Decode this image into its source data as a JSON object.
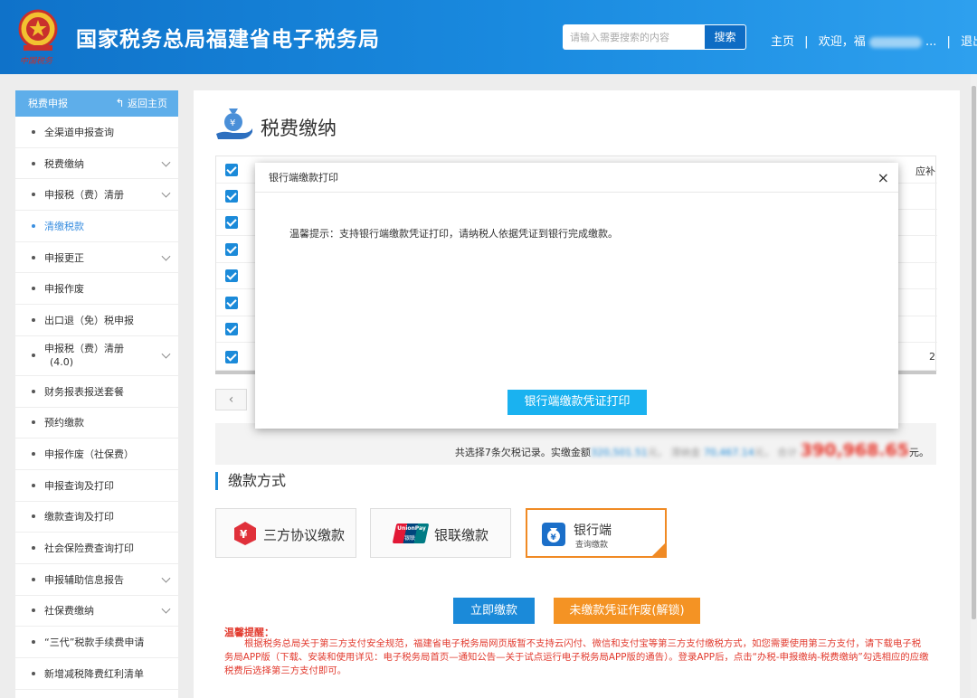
{
  "header": {
    "emblem_text": "中国税务",
    "title": "国家税务总局福建省电子税务局",
    "search_placeholder": "请输入需要搜索的内容",
    "search_button": "搜索",
    "nav_home": "主页",
    "nav_welcome": "欢迎，福",
    "nav_ellipsis": "...",
    "nav_logout": "退出",
    "separator": "|"
  },
  "sidebar": {
    "title": "税费申报",
    "back_label": "返回主页",
    "items": [
      {
        "label": "全渠道申报查询",
        "expandable": false
      },
      {
        "label": "税费缴纳",
        "expandable": true
      },
      {
        "label": "申报税（费）清册",
        "expandable": true
      },
      {
        "label": "清缴税款",
        "expandable": false,
        "active": true
      },
      {
        "label": "申报更正",
        "expandable": true
      },
      {
        "label": "申报作废",
        "expandable": false
      },
      {
        "label": "出口退（免）税申报",
        "expandable": false
      },
      {
        "label": "申报税（费）清册",
        "label2": "(4.0)",
        "expandable": true
      },
      {
        "label": "财务报表报送套餐",
        "expandable": false
      },
      {
        "label": "预约缴款",
        "expandable": false
      },
      {
        "label": "申报作废（社保费）",
        "expandable": false
      },
      {
        "label": "申报查询及打印",
        "expandable": false
      },
      {
        "label": "缴款查询及打印",
        "expandable": false
      },
      {
        "label": "社会保险费查询打印",
        "expandable": false
      },
      {
        "label": "申报辅助信息报告",
        "expandable": true
      },
      {
        "label": "社保费缴纳",
        "expandable": true
      },
      {
        "label": "“三代”税款手续费申请",
        "expandable": false
      },
      {
        "label": "新增减税降费红利清单",
        "expandable": false
      }
    ]
  },
  "main": {
    "page_title": "税费缴纳",
    "table": {
      "partial_header": "应补",
      "partial_value": "2",
      "rows_checked": 8
    },
    "pager_prev": "‹",
    "summary": {
      "prefix": "共选择7条欠税记录。实缴金额",
      "amount1": "320,501.51",
      "unit1": "元，",
      "mid_label": "滞纳金",
      "amount2": "70,467.14",
      "unit2": "元，",
      "total_label": "合计",
      "total": "390,968.65",
      "suffix": "元。"
    },
    "section_title": "缴款方式",
    "pay_methods": [
      {
        "label": "三方协议缴款",
        "icon": "sanfang-icon"
      },
      {
        "label": "银联缴款",
        "icon": "unionpay-icon",
        "logo_text": "UnionPay",
        "logo_sub": "银联"
      },
      {
        "label": "银行端",
        "sub": "查询缴款",
        "icon": "bank-yuan-icon",
        "selected": true
      }
    ],
    "pay_now_button": "立即缴款",
    "void_button": "未缴款凭证作废(解锁)",
    "tip_title": "温馨提醒：",
    "tip_text": "根据税务总局关于第三方支付安全规范，福建省电子税务局网页版暂不支持云闪付、微信和支付宝等第三方支付缴税方式，如您需要使用第三方支付，请下载电子税务局APP版（下载、安装和使用详见：电子税务局首页—通知公告—关于试点运行电子税务局APP版的通告）。登录APP后，点击“办税-申报缴纳-税费缴纳”勾选相应的应缴税费后选择第三方支付即可。"
  },
  "modal": {
    "title": "银行端缴款打印",
    "close": "×",
    "body": "温馨提示：支持银行端缴款凭证打印，请纳税人依据凭证到银行完成缴款。",
    "button": "银行端缴款凭证打印"
  },
  "colors": {
    "header_blue": "#1a8be0",
    "accent_blue": "#1b8ad9",
    "modal_button": "#1ab2f0",
    "orange": "#f49324",
    "tip_red": "#e23b2f"
  }
}
